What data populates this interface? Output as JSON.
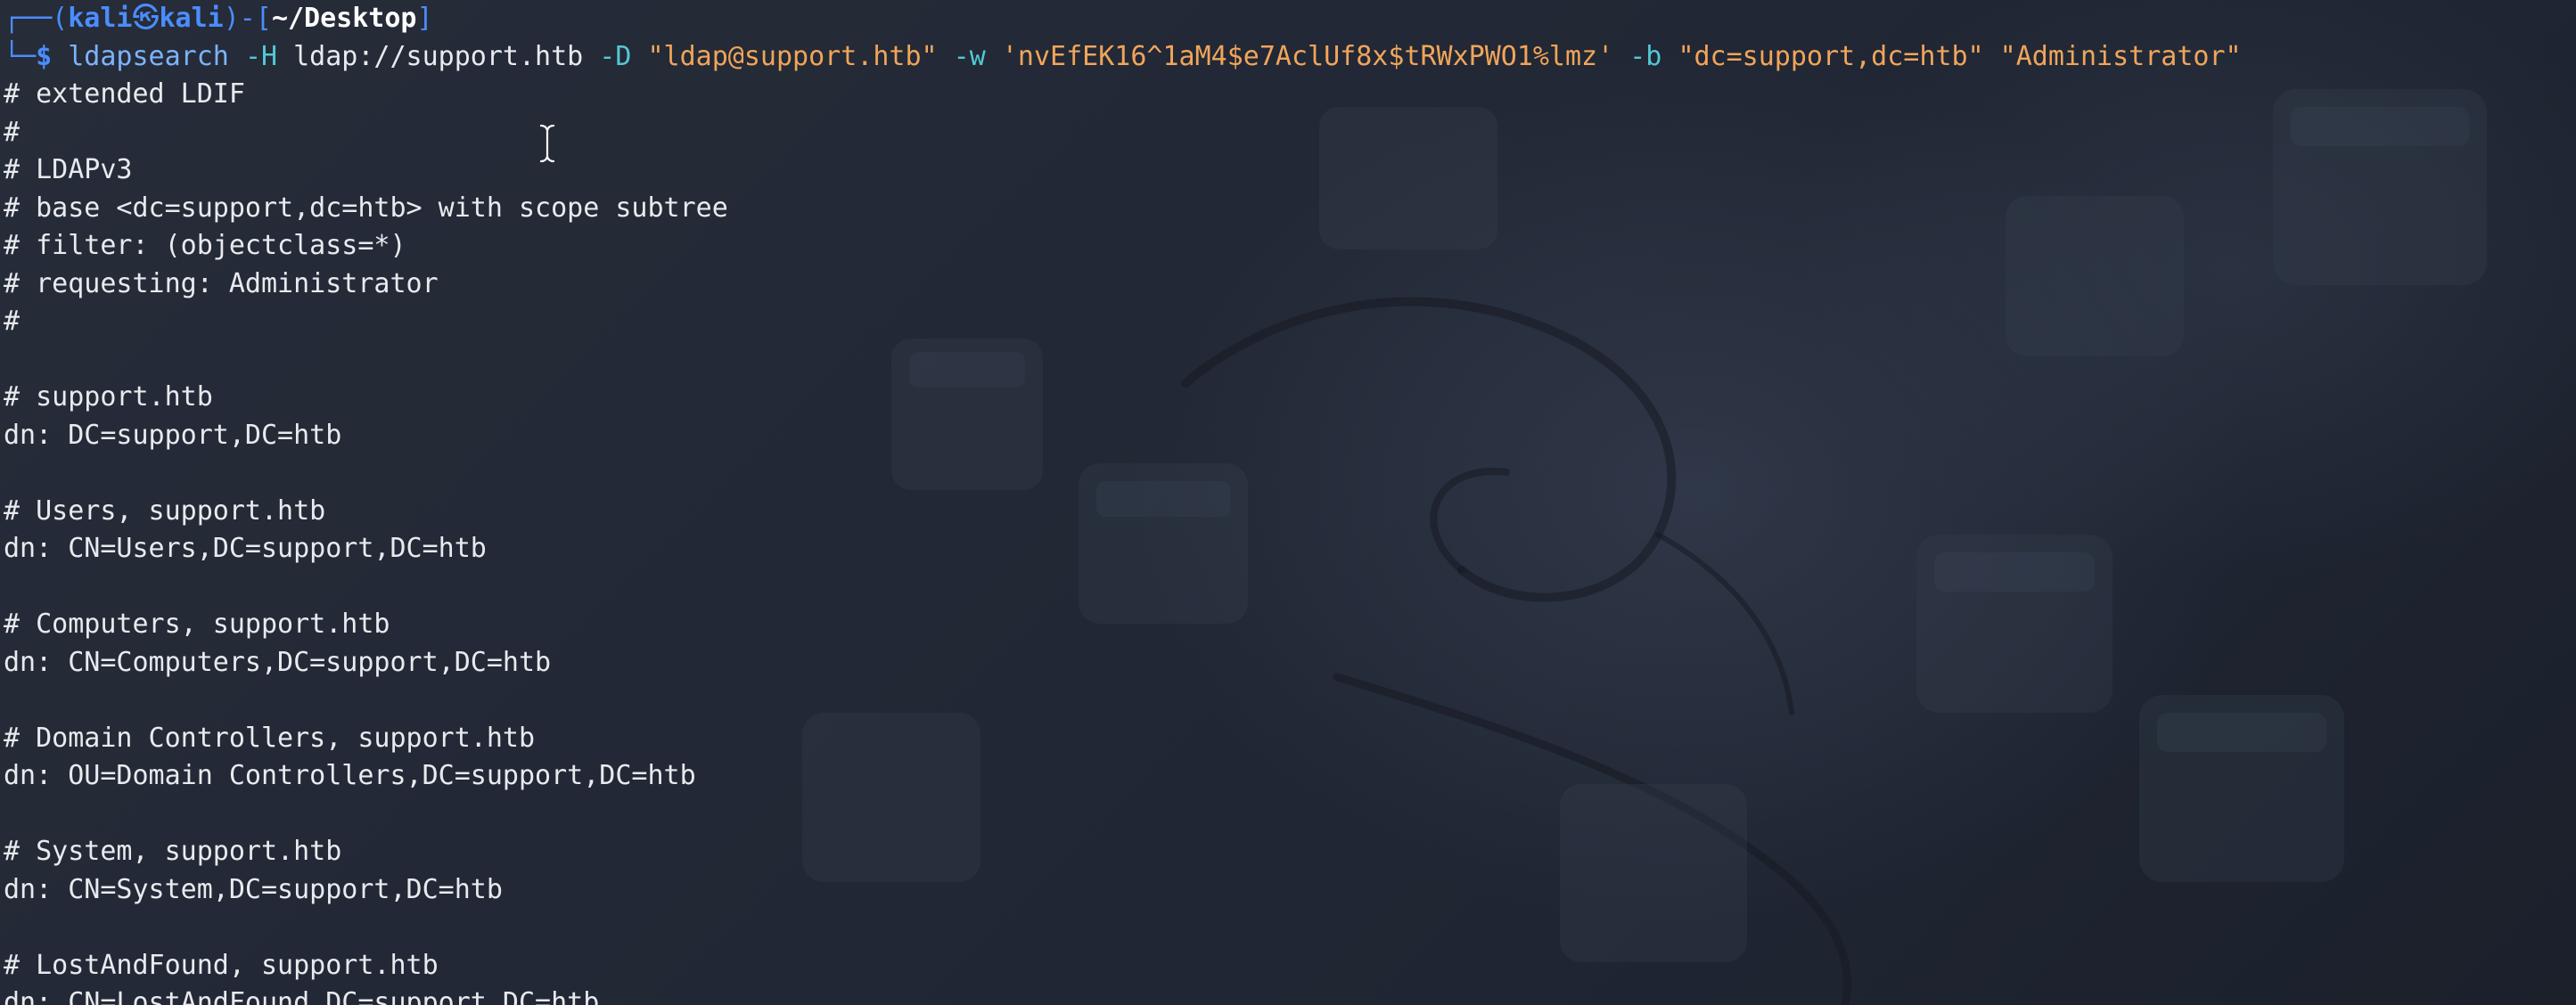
{
  "prompt": {
    "corner_top": "┌──(",
    "user": "kali",
    "at_symbol": "㉿",
    "host": "kali",
    "mid": ")-[",
    "cwd": "~/Desktop",
    "close": "]",
    "corner_bottom": "└─",
    "dollar": "$"
  },
  "command": {
    "program": "ldapsearch",
    "flag_h": "-H",
    "url": "ldap://support.htb",
    "flag_d": "-D",
    "bind_dn": "\"ldap@support.htb\"",
    "flag_w": "-w",
    "password": "'nvEfEK16^1aM4$e7AclUf8x$tRWxPWO1%lmz'",
    "flag_b": "-b",
    "base_dn": "\"dc=support,dc=htb\"",
    "attribute": "\"Administrator\""
  },
  "output_lines": [
    "# extended LDIF",
    "#",
    "# LDAPv3",
    "# base <dc=support,dc=htb> with scope subtree",
    "# filter: (objectclass=*)",
    "# requesting: Administrator",
    "#",
    "",
    "# support.htb",
    "dn: DC=support,DC=htb",
    "",
    "# Users, support.htb",
    "dn: CN=Users,DC=support,DC=htb",
    "",
    "# Computers, support.htb",
    "dn: CN=Computers,DC=support,DC=htb",
    "",
    "# Domain Controllers, support.htb",
    "dn: OU=Domain Controllers,DC=support,DC=htb",
    "",
    "# System, support.htb",
    "dn: CN=System,DC=support,DC=htb",
    "",
    "# LostAndFound, support.htb",
    "dn: CN=LostAndFound,DC=support,DC=htb"
  ],
  "colors": {
    "background": "#1e2430",
    "prompt_blue": "#4b8dff",
    "command": "#7cb3ff",
    "flag": "#53c7d6",
    "string": "#f0a55a",
    "text": "#e8eaee"
  },
  "cursor_icon": "text-cursor-icon"
}
